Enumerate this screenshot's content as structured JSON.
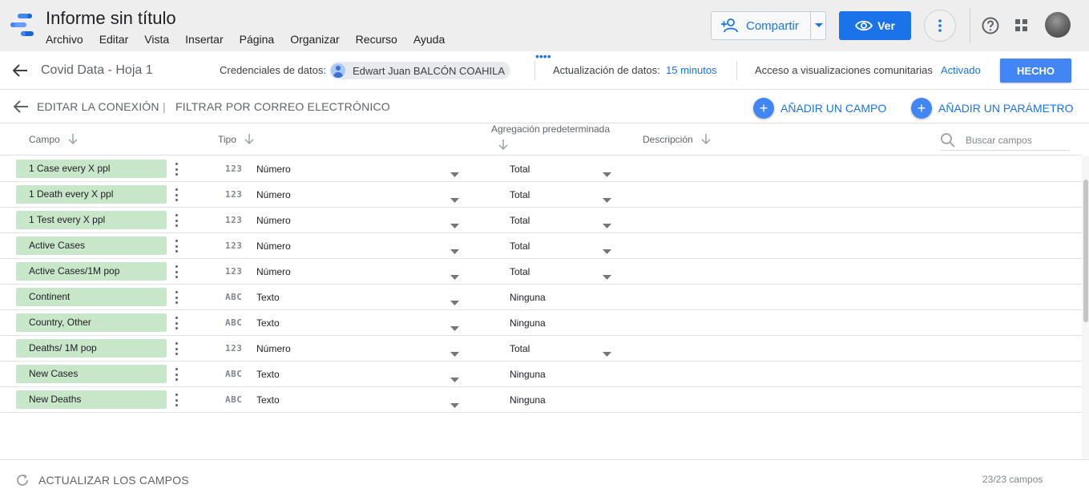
{
  "app": {
    "title": "Informe sin título",
    "menu": [
      "Archivo",
      "Editar",
      "Vista",
      "Insertar",
      "Página",
      "Organizar",
      "Recurso",
      "Ayuda"
    ],
    "share_label": "Compartir",
    "view_label": "Ver"
  },
  "datasource": {
    "name": "Covid Data - Hoja 1",
    "credentials_label": "Credenciales de datos:",
    "credentials_user": "Edwart Juan BALCÓN COAHILA",
    "refresh_label": "Actualización de datos:",
    "refresh_value": "15 minutos",
    "access_label": "Acceso a visualizaciones comunitarias",
    "access_value": "Activado",
    "done_label": "HECHO"
  },
  "actions": {
    "edit_connection": "EDITAR LA CONEXIÓN",
    "separator": "|",
    "filter_email": "FILTRAR POR CORREO ELECTRÓNICO",
    "add_field": "AÑADIR UN CAMPO",
    "add_parameter": "AÑADIR UN PARÁMETRO"
  },
  "table": {
    "headers": {
      "field": "Campo",
      "type": "Tipo",
      "aggregation": "Agregación predeterminada",
      "description": "Descripción"
    },
    "search_placeholder": "Buscar campos",
    "rows": [
      {
        "field": "1 Case every X ppl",
        "type_icon": "123",
        "type": "Número",
        "aggregation": "Total",
        "agg_dropdown": true
      },
      {
        "field": "1 Death every X ppl",
        "type_icon": "123",
        "type": "Número",
        "aggregation": "Total",
        "agg_dropdown": true
      },
      {
        "field": "1 Test every X ppl",
        "type_icon": "123",
        "type": "Número",
        "aggregation": "Total",
        "agg_dropdown": true
      },
      {
        "field": "Active Cases",
        "type_icon": "123",
        "type": "Número",
        "aggregation": "Total",
        "agg_dropdown": true
      },
      {
        "field": "Active Cases/1M pop",
        "type_icon": "123",
        "type": "Número",
        "aggregation": "Total",
        "agg_dropdown": true
      },
      {
        "field": "Continent",
        "type_icon": "ABC",
        "type": "Texto",
        "aggregation": "Ninguna",
        "agg_dropdown": false
      },
      {
        "field": "Country, Other",
        "type_icon": "ABC",
        "type": "Texto",
        "aggregation": "Ninguna",
        "agg_dropdown": false
      },
      {
        "field": "Deaths/ 1M pop",
        "type_icon": "123",
        "type": "Número",
        "aggregation": "Total",
        "agg_dropdown": true
      },
      {
        "field": "New Cases",
        "type_icon": "ABC",
        "type": "Texto",
        "aggregation": "Ninguna",
        "agg_dropdown": false
      },
      {
        "field": "New Deaths",
        "type_icon": "ABC",
        "type": "Texto",
        "aggregation": "Ninguna",
        "agg_dropdown": false
      }
    ]
  },
  "footer": {
    "refresh_fields": "ACTUALIZAR LOS CAMPOS",
    "field_count": "23/23 campos"
  },
  "colors": {
    "accent": "#1a73e8",
    "done_button": "#4285f4",
    "field_chip": "#c8e6c9",
    "app_bar": "#eeeeee"
  }
}
